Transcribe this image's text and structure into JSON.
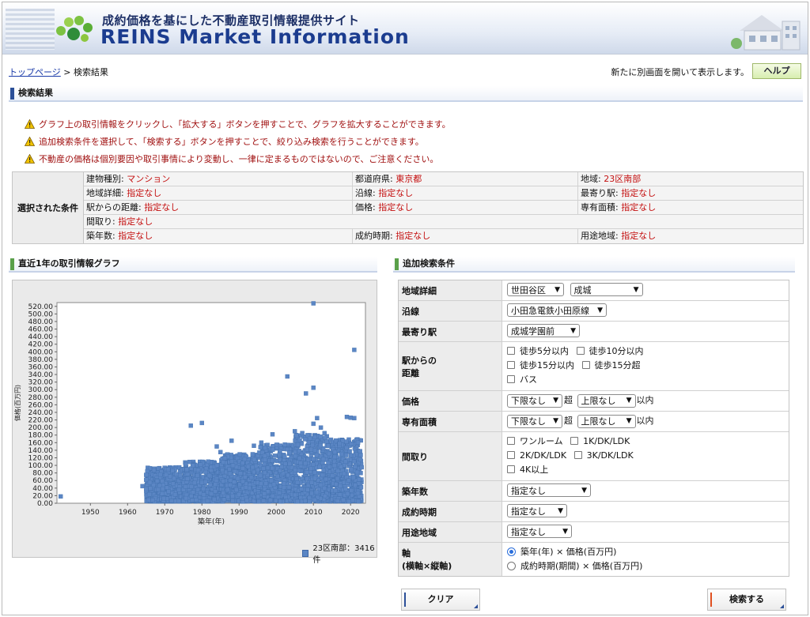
{
  "header": {
    "subtitle": "成約価格を基にした不動産取引情報提供サイト",
    "title": "REINS Market Information",
    "logo_icon": "green-dots-logo-icon",
    "house_icon": "house-illustration-icon"
  },
  "breadcrumb": {
    "home": "トップページ",
    "sep": " > ",
    "current": "検索結果"
  },
  "newwin_text": "新たに別画面を開いて表示します。",
  "help_label": "ヘルプ",
  "results_heading": "検索結果",
  "notes": [
    "グラフ上の取引情報をクリックし、「拡大する」ボタンを押すことで、グラフを拡大することができます。",
    "追加検索条件を選択して、「検索する」ボタンを押すことで、絞り込み検索を行うことができます。",
    "不動産の価格は個別要因や取引事情により変動し、一律に定まるものではないので、ご注意ください。"
  ],
  "conditions": {
    "label": "選択された条件",
    "rows": [
      [
        {
          "k": "建物種別:",
          "v": "マンション"
        },
        {
          "k": "都道府県:",
          "v": "東京都"
        },
        {
          "k": "地域:",
          "v": "23区南部"
        }
      ],
      [
        {
          "k": "地域詳細:",
          "v": "指定なし"
        },
        {
          "k": "沿線:",
          "v": "指定なし"
        },
        {
          "k": "最寄り駅:",
          "v": "指定なし"
        }
      ],
      [
        {
          "k": "駅からの距離:",
          "v": "指定なし"
        },
        {
          "k": "価格:",
          "v": "指定なし"
        },
        {
          "k": "専有面積:",
          "v": "指定なし"
        }
      ],
      [
        {
          "k": "間取り:",
          "v": "指定なし"
        }
      ],
      [
        {
          "k": "築年数:",
          "v": "指定なし"
        },
        {
          "k": "成約時期:",
          "v": "指定なし"
        },
        {
          "k": "用途地域:",
          "v": "指定なし"
        }
      ]
    ]
  },
  "chart_heading": "直近1年の取引情報グラフ",
  "chart_data": {
    "type": "scatter",
    "xlabel": "築年(年)",
    "ylabel": "価格(百万円)",
    "xlim": [
      1941,
      2024
    ],
    "ylim": [
      0,
      530
    ],
    "x_ticks": [
      "1950",
      "1960",
      "1970",
      "1980",
      "1990",
      "2000",
      "2010",
      "2020"
    ],
    "y_ticks": [
      "0.00",
      "20.00",
      "40.00",
      "60.00",
      "80.00",
      "100.00",
      "120.00",
      "140.00",
      "160.00",
      "180.00",
      "200.00",
      "220.00",
      "240.00",
      "260.00",
      "280.00",
      "300.00",
      "320.00",
      "340.00",
      "360.00",
      "380.00",
      "400.00",
      "420.00",
      "440.00",
      "460.00",
      "480.00",
      "500.00",
      "520.00"
    ],
    "legend": "23区南部：3416件",
    "color": "#5b86c4",
    "outliers": [
      [
        1942,
        18
      ],
      [
        1964,
        45
      ],
      [
        1965,
        62
      ],
      [
        1965,
        75
      ],
      [
        1966,
        55
      ],
      [
        1977,
        205
      ],
      [
        1980,
        212
      ],
      [
        1984,
        150
      ],
      [
        1985,
        135
      ],
      [
        1988,
        165
      ],
      [
        1994,
        152
      ],
      [
        1996,
        160
      ],
      [
        1999,
        182
      ],
      [
        2003,
        335
      ],
      [
        2005,
        190
      ],
      [
        2007,
        185
      ],
      [
        2008,
        290
      ],
      [
        2010,
        528
      ],
      [
        2010,
        305
      ],
      [
        2010,
        210
      ],
      [
        2011,
        225
      ],
      [
        2012,
        200
      ],
      [
        2013,
        185
      ],
      [
        2019,
        228
      ],
      [
        2020,
        226
      ],
      [
        2021,
        405
      ],
      [
        2021,
        225
      ],
      [
        2022,
        160
      ],
      [
        2023,
        95
      ]
    ],
    "bulk_ranges": [
      {
        "from": 1965,
        "to": 1975,
        "max": 90
      },
      {
        "from": 1975,
        "to": 1985,
        "max": 105
      },
      {
        "from": 1985,
        "to": 1995,
        "max": 125
      },
      {
        "from": 1995,
        "to": 2005,
        "max": 150
      },
      {
        "from": 2005,
        "to": 2015,
        "max": 175
      },
      {
        "from": 2015,
        "to": 2023,
        "max": 165
      }
    ]
  },
  "form_heading": "追加検索条件",
  "form": {
    "area_detail": {
      "label": "地域詳細",
      "sel1": "世田谷区",
      "sel2": "成城"
    },
    "line": {
      "label": "沿線",
      "sel": "小田急電鉄小田原線"
    },
    "station": {
      "label": "最寄り駅",
      "sel": "成城学園前"
    },
    "distance": {
      "label1": "駅からの",
      "label2": "距離",
      "opts": [
        "徒歩5分以内",
        "徒歩10分以内",
        "徒歩15分以内",
        "徒歩15分超",
        "バス"
      ]
    },
    "price": {
      "label": "価格",
      "low": "下限なし",
      "mid": "超",
      "high": "上限なし",
      "end": "以内"
    },
    "area": {
      "label": "専有面積",
      "low": "下限なし",
      "mid": "超",
      "high": "上限なし",
      "end": "以内"
    },
    "layout": {
      "label": "間取り",
      "opts": [
        "ワンルーム",
        "1K/DK/LDK",
        "2K/DK/LDK",
        "3K/DK/LDK",
        "4K以上"
      ]
    },
    "age": {
      "label": "築年数",
      "sel": "指定なし"
    },
    "period": {
      "label": "成約時期",
      "sel": "指定なし"
    },
    "zoning": {
      "label": "用途地域",
      "sel": "指定なし"
    },
    "axis": {
      "label1": "軸",
      "label2": "(横軸×縦軸)",
      "opt1": "築年(年) × 価格(百万円)",
      "opt2": "成約時期(期間) × 価格(百万円)"
    }
  },
  "buttons": {
    "clear": "クリア",
    "search": "検索する"
  }
}
